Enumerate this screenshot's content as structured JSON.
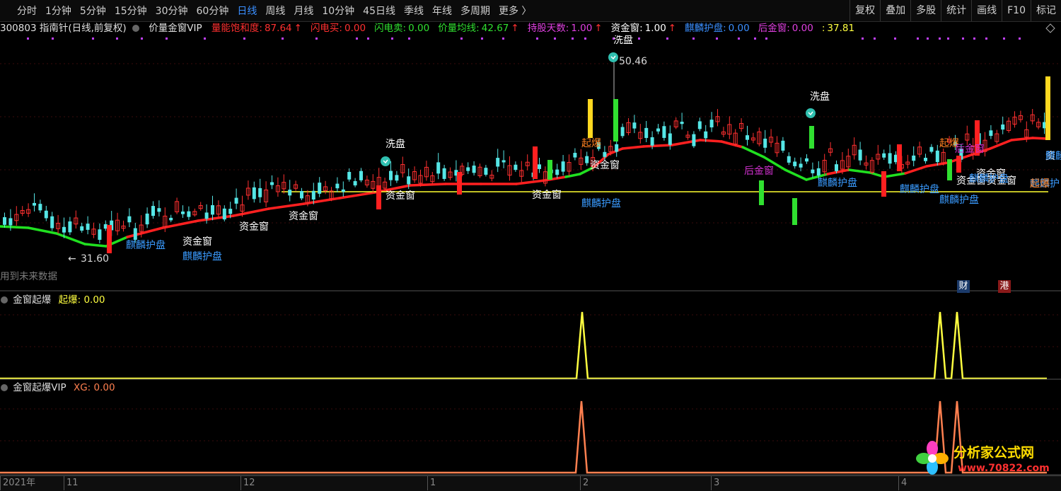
{
  "toolbar": {
    "periods": [
      {
        "label": "分时",
        "active": false
      },
      {
        "label": "1分钟",
        "active": false
      },
      {
        "label": "5分钟",
        "active": false
      },
      {
        "label": "15分钟",
        "active": false
      },
      {
        "label": "30分钟",
        "active": false
      },
      {
        "label": "60分钟",
        "active": false
      },
      {
        "label": "日线",
        "active": true
      },
      {
        "label": "周线",
        "active": false
      },
      {
        "label": "月线",
        "active": false
      },
      {
        "label": "10分钟",
        "active": false
      },
      {
        "label": "45日线",
        "active": false
      },
      {
        "label": "季线",
        "active": false
      },
      {
        "label": "年线",
        "active": false
      },
      {
        "label": "多周期",
        "active": false
      },
      {
        "label": "更多 〉",
        "active": false
      }
    ],
    "right_buttons": [
      "复权",
      "叠加",
      "多股",
      "统计",
      "画线",
      "F10",
      "标记"
    ]
  },
  "infobar": {
    "stock": "300803 指南针(日线,前复权)",
    "indicator": "价量金窗VIP",
    "items": [
      {
        "label": "量能饱和度:",
        "value": "87.64",
        "arrow": "↑",
        "color": "#ff3030"
      },
      {
        "label": "闪电买:",
        "value": "0.00",
        "arrow": "",
        "color": "#ff3030"
      },
      {
        "label": "闪电卖:",
        "value": "0.00",
        "arrow": "",
        "color": "#30e030"
      },
      {
        "label": "价量均线:",
        "value": "42.67",
        "arrow": "↑",
        "color": "#30e030"
      },
      {
        "label": "持股天数:",
        "value": "1.00",
        "arrow": "↑",
        "color": "#e040e0"
      },
      {
        "label": "资金窗:",
        "value": "1.00",
        "arrow": "↑",
        "color": "#ffffff"
      },
      {
        "label": "麒麟护盘:",
        "value": "0.00",
        "arrow": "",
        "color": "#3a8fff"
      },
      {
        "label": "后金窗:",
        "value": "0.00",
        "arrow": "",
        "color": "#e040e0"
      },
      {
        "label": ":",
        "value": "37.81",
        "arrow": "",
        "color": "#ffff40"
      }
    ]
  },
  "main_chart": {
    "high_label": "50.46",
    "low_label": "31.60",
    "future_note": "用到未来数据",
    "annotations": [
      {
        "text": "洗盘",
        "kind": "wash"
      },
      {
        "text": "洗盘",
        "kind": "wash"
      },
      {
        "text": "洗盘",
        "kind": "wash"
      },
      {
        "text": "资金窗",
        "kind": "zjc"
      },
      {
        "text": "资金窗",
        "kind": "zjc"
      },
      {
        "text": "资金窗",
        "kind": "zjc"
      },
      {
        "text": "资金窗",
        "kind": "zjc"
      },
      {
        "text": "资金窗",
        "kind": "zjc"
      },
      {
        "text": "资金窗",
        "kind": "zjc"
      },
      {
        "text": "资金窗",
        "kind": "zjc"
      },
      {
        "text": "资金窗",
        "kind": "zjc"
      },
      {
        "text": "资金窗",
        "kind": "zjc"
      },
      {
        "text": "资",
        "kind": "zjc"
      },
      {
        "text": "麒麟护盘",
        "kind": "qlhp"
      },
      {
        "text": "麒麟护盘",
        "kind": "qlhp"
      },
      {
        "text": "麒麟护盘",
        "kind": "qlhp"
      },
      {
        "text": "麒麟护盘",
        "kind": "qlhp"
      },
      {
        "text": "麒麟护盘",
        "kind": "qlhp"
      },
      {
        "text": "麒麟护盘",
        "kind": "qlhp"
      },
      {
        "text": "麒麟护盘",
        "kind": "qlhp"
      },
      {
        "text": "麒麟护盘",
        "kind": "qlhp"
      },
      {
        "text": "麒麟护",
        "kind": "qlhp"
      },
      {
        "text": "起爆",
        "kind": "qb"
      },
      {
        "text": "起爆",
        "kind": "qb"
      },
      {
        "text": "起爆",
        "kind": "qb"
      },
      {
        "text": "后金窗",
        "kind": "hjc"
      },
      {
        "text": "后金窗",
        "kind": "hjc"
      }
    ],
    "badges": [
      {
        "text": "财",
        "bg": "#1b3a6a"
      },
      {
        "text": "港",
        "bg": "#8a1a1a"
      }
    ],
    "colors": {
      "up": "#ff3030",
      "down": "#55e6e6",
      "ma_up": "#ff2020",
      "ma_down": "#20e020",
      "level_line": "#ffff30"
    }
  },
  "sub1": {
    "title": "金窗起爆",
    "var_label": "起爆:",
    "var_value": "0.00",
    "color": "#ffff40"
  },
  "sub2": {
    "title": "金窗起爆VIP",
    "var_label": "XG:",
    "var_value": "0.00",
    "color": "#ff8050"
  },
  "date_axis": [
    "2021年",
    "11",
    "12",
    "1",
    "2",
    "3",
    "4"
  ],
  "watermark": {
    "line1": "分析家公式网",
    "line2": "www.70822.com"
  }
}
